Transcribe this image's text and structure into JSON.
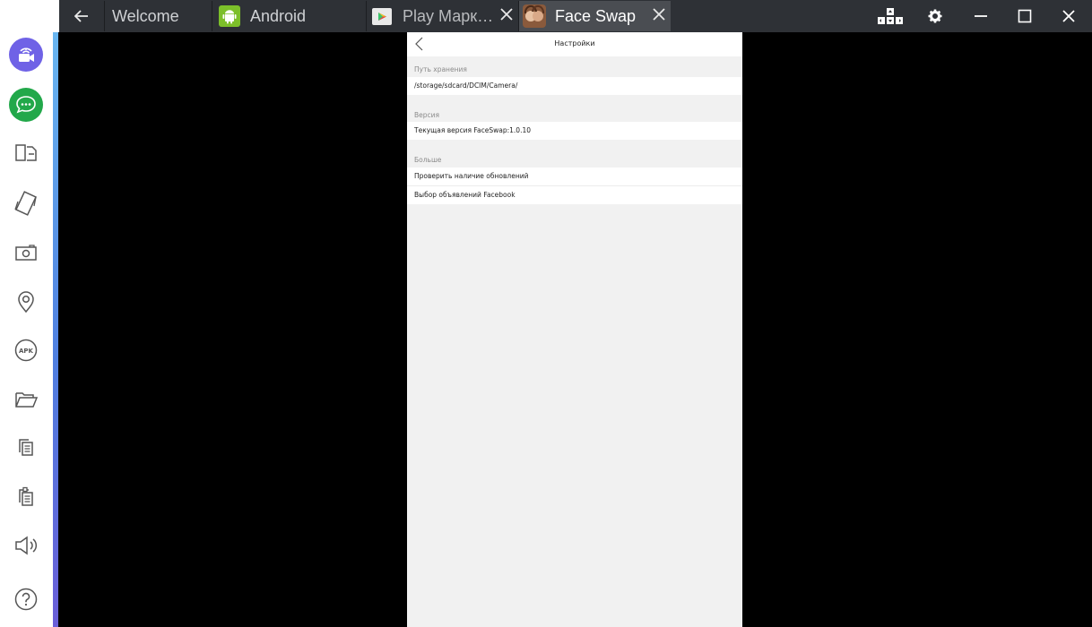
{
  "tabs": [
    {
      "label": "Welcome",
      "closable": false,
      "active": false
    },
    {
      "label": "Android",
      "closable": false,
      "active": false
    },
    {
      "label": "Play Марк…",
      "closable": true,
      "active": false
    },
    {
      "label": "Face Swap",
      "closable": true,
      "active": true
    }
  ],
  "sidebar": {
    "items": [
      "video-call-icon",
      "chat-icon",
      "multi-screen-icon",
      "rotate-icon",
      "camera-icon",
      "location-icon",
      "apk-icon",
      "folder-icon",
      "copy-icon",
      "paste-icon",
      "volume-icon",
      "help-icon"
    ],
    "apk_label": "APK"
  },
  "colors": {
    "accent_purple": "#6f62e6",
    "accent_green": "#22a84a",
    "tabbar_bg": "#2e3136"
  },
  "settings": {
    "title": "Настройки",
    "sections": [
      {
        "header": "Путь хранения",
        "rows": [
          "/storage/sdcard/DCIM/Camera/"
        ]
      },
      {
        "header": "Версия",
        "rows": [
          "Текущая версия FaceSwap:1.0.10"
        ]
      },
      {
        "header": "Больше",
        "rows": [
          "Проверить наличие обновлений",
          "Выбор объявлений Facebook"
        ]
      }
    ]
  }
}
